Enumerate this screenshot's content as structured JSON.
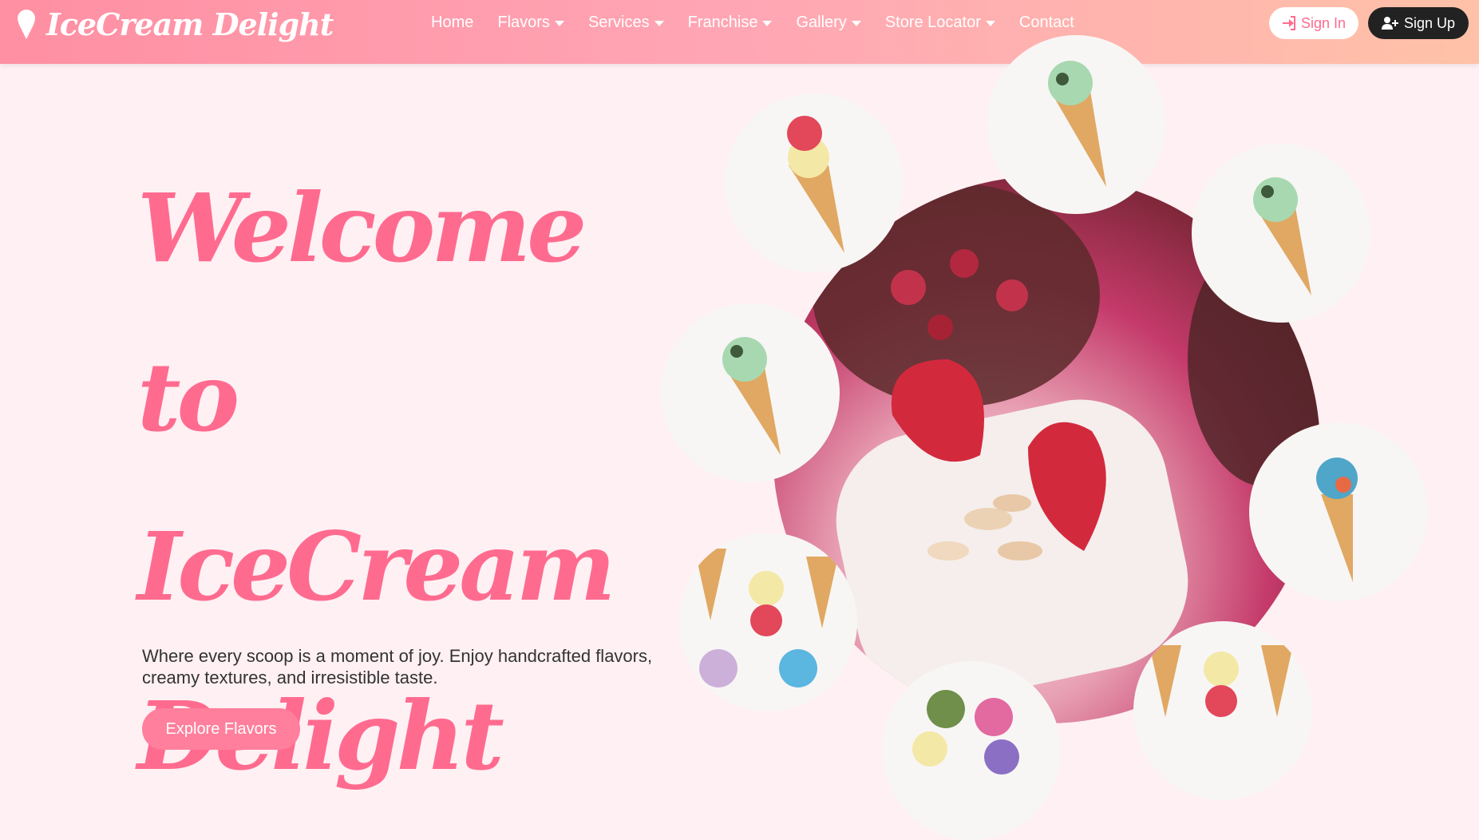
{
  "brand": {
    "name": "IceCream Delight",
    "icon": "ice-cream-icon"
  },
  "nav": {
    "items": [
      {
        "label": "Home",
        "dropdown": false
      },
      {
        "label": "Flavors",
        "dropdown": true
      },
      {
        "label": "Services",
        "dropdown": true
      },
      {
        "label": "Franchise",
        "dropdown": true
      },
      {
        "label": "Gallery",
        "dropdown": true
      },
      {
        "label": "Store Locator",
        "dropdown": true
      },
      {
        "label": "Contact",
        "dropdown": false
      }
    ],
    "sign_in": "Sign In",
    "sign_up": "Sign Up"
  },
  "hero": {
    "title_line1": "Welcome to",
    "title_line2": "IceCream",
    "title_line3": "Delight",
    "description": "Where every scoop is a moment of joy. Enjoy handcrafted flavors, creamy textures, and irresistible taste.",
    "cta": "Explore Flavors"
  },
  "colors": {
    "header_start": "#ff8fa3",
    "header_end": "#ffc2a8",
    "accent": "#ff6b8f",
    "page_bg": "#fff0f3",
    "dark_button": "#222222"
  },
  "gallery": {
    "main_image": "strawberry-popsicle-photo",
    "thumbnails": [
      "mint-cone-photo",
      "strawberry-cone-photo",
      "mint-cone-photo",
      "mint-cone-photo",
      "blue-cone-photo",
      "assorted-cones-photo",
      "mixed-scoops-photo",
      "assorted-cones-photo"
    ]
  }
}
